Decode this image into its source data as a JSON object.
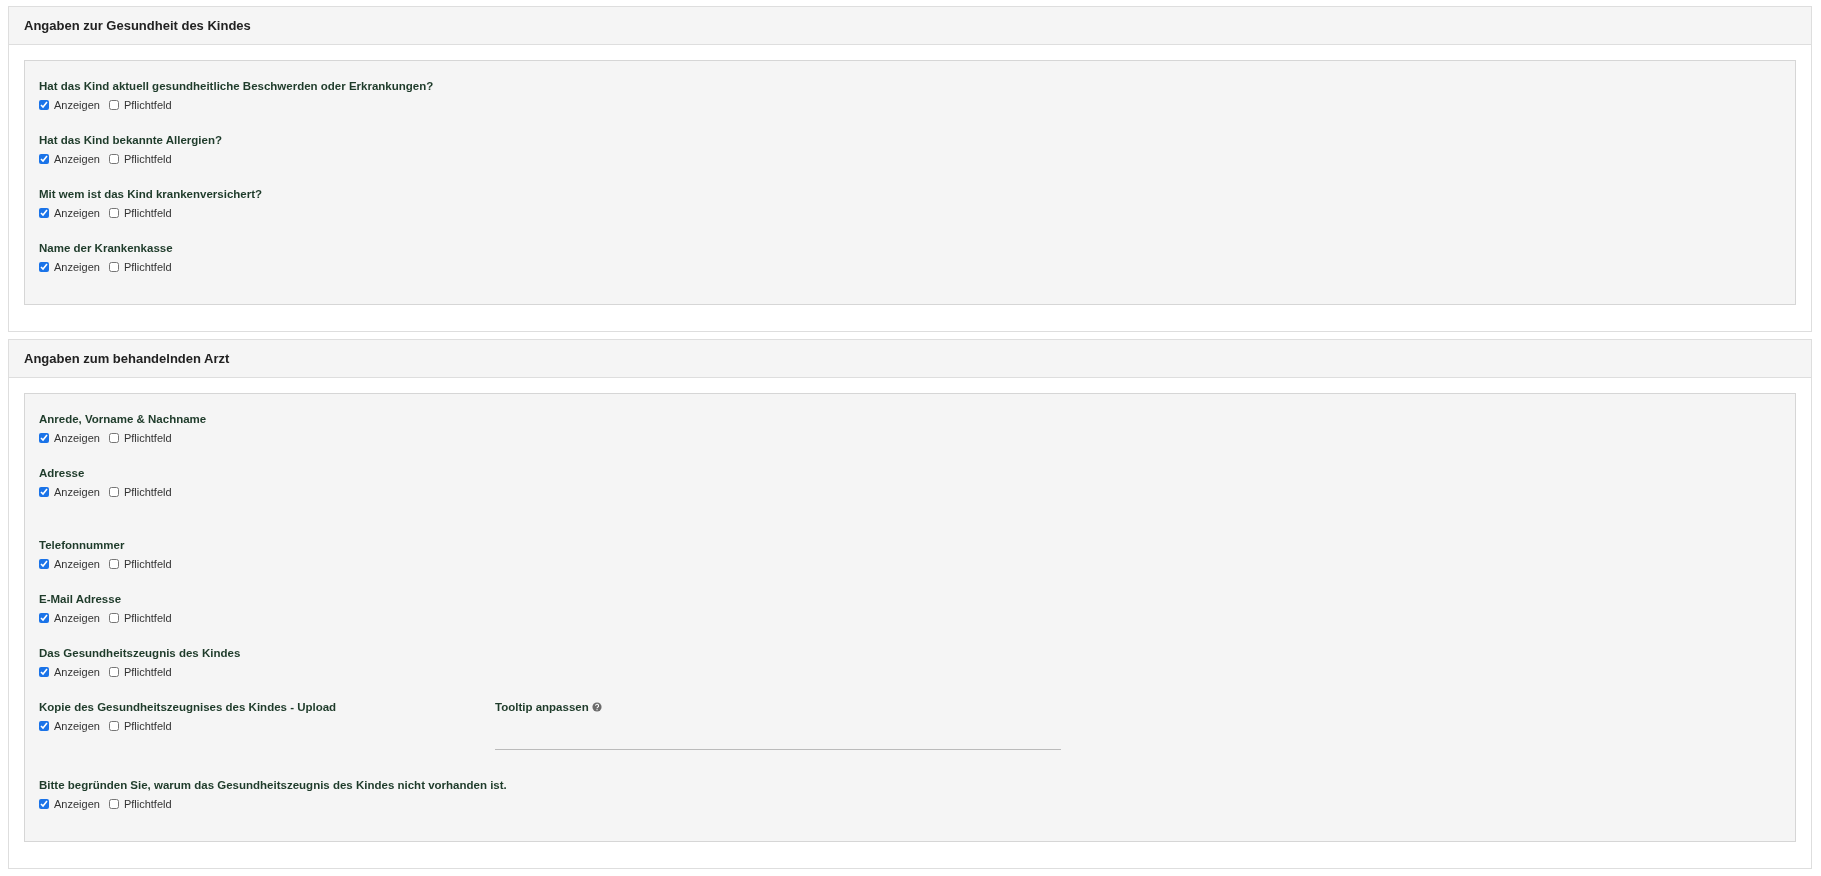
{
  "panels": [
    {
      "title": "Angaben zur Gesundheit des Kindes",
      "fields": [
        {
          "label": "Hat das Kind aktuell gesundheitliche Beschwerden oder Erkrankungen?",
          "options": [
            {
              "label": "Anzeigen",
              "checked": true
            },
            {
              "label": "Pflichtfeld",
              "checked": false
            }
          ]
        },
        {
          "label": "Hat das Kind bekannte Allergien?",
          "options": [
            {
              "label": "Anzeigen",
              "checked": true
            },
            {
              "label": "Pflichtfeld",
              "checked": false
            }
          ]
        },
        {
          "label": "Mit wem ist das Kind krankenversichert?",
          "options": [
            {
              "label": "Anzeigen",
              "checked": true
            },
            {
              "label": "Pflichtfeld",
              "checked": false
            }
          ]
        },
        {
          "label": "Name der Krankenkasse",
          "options": [
            {
              "label": "Anzeigen",
              "checked": true
            },
            {
              "label": "Pflichtfeld",
              "checked": false
            }
          ]
        }
      ]
    },
    {
      "title": "Angaben zum behandelnden Arzt",
      "fields": [
        {
          "label": "Anrede, Vorname & Nachname",
          "options": [
            {
              "label": "Anzeigen",
              "checked": true
            },
            {
              "label": "Pflichtfeld",
              "checked": false
            }
          ]
        },
        {
          "label": "Adresse",
          "options": [
            {
              "label": "Anzeigen",
              "checked": true
            },
            {
              "label": "Pflichtfeld",
              "checked": false
            }
          ]
        },
        {
          "label": "Telefonnummer",
          "options": [
            {
              "label": "Anzeigen",
              "checked": true
            },
            {
              "label": "Pflichtfeld",
              "checked": false
            }
          ]
        },
        {
          "label": "E-Mail Adresse",
          "options": [
            {
              "label": "Anzeigen",
              "checked": true
            },
            {
              "label": "Pflichtfeld",
              "checked": false
            }
          ]
        },
        {
          "label": "Das Gesundheitszeugnis des Kindes",
          "options": [
            {
              "label": "Anzeigen",
              "checked": true
            },
            {
              "label": "Pflichtfeld",
              "checked": false
            }
          ]
        },
        {
          "label": "Kopie des Gesundheitszeugnises des Kindes - Upload",
          "options": [
            {
              "label": "Anzeigen",
              "checked": true
            },
            {
              "label": "Pflichtfeld",
              "checked": false
            }
          ],
          "tooltip": {
            "label": "Tooltip anpassen"
          }
        },
        {
          "label": "Bitte begründen Sie, warum das Gesundheitszeugnis des Kindes nicht vorhanden ist.",
          "options": [
            {
              "label": "Anzeigen",
              "checked": true
            },
            {
              "label": "Pflichtfeld",
              "checked": false
            }
          ]
        }
      ]
    }
  ]
}
